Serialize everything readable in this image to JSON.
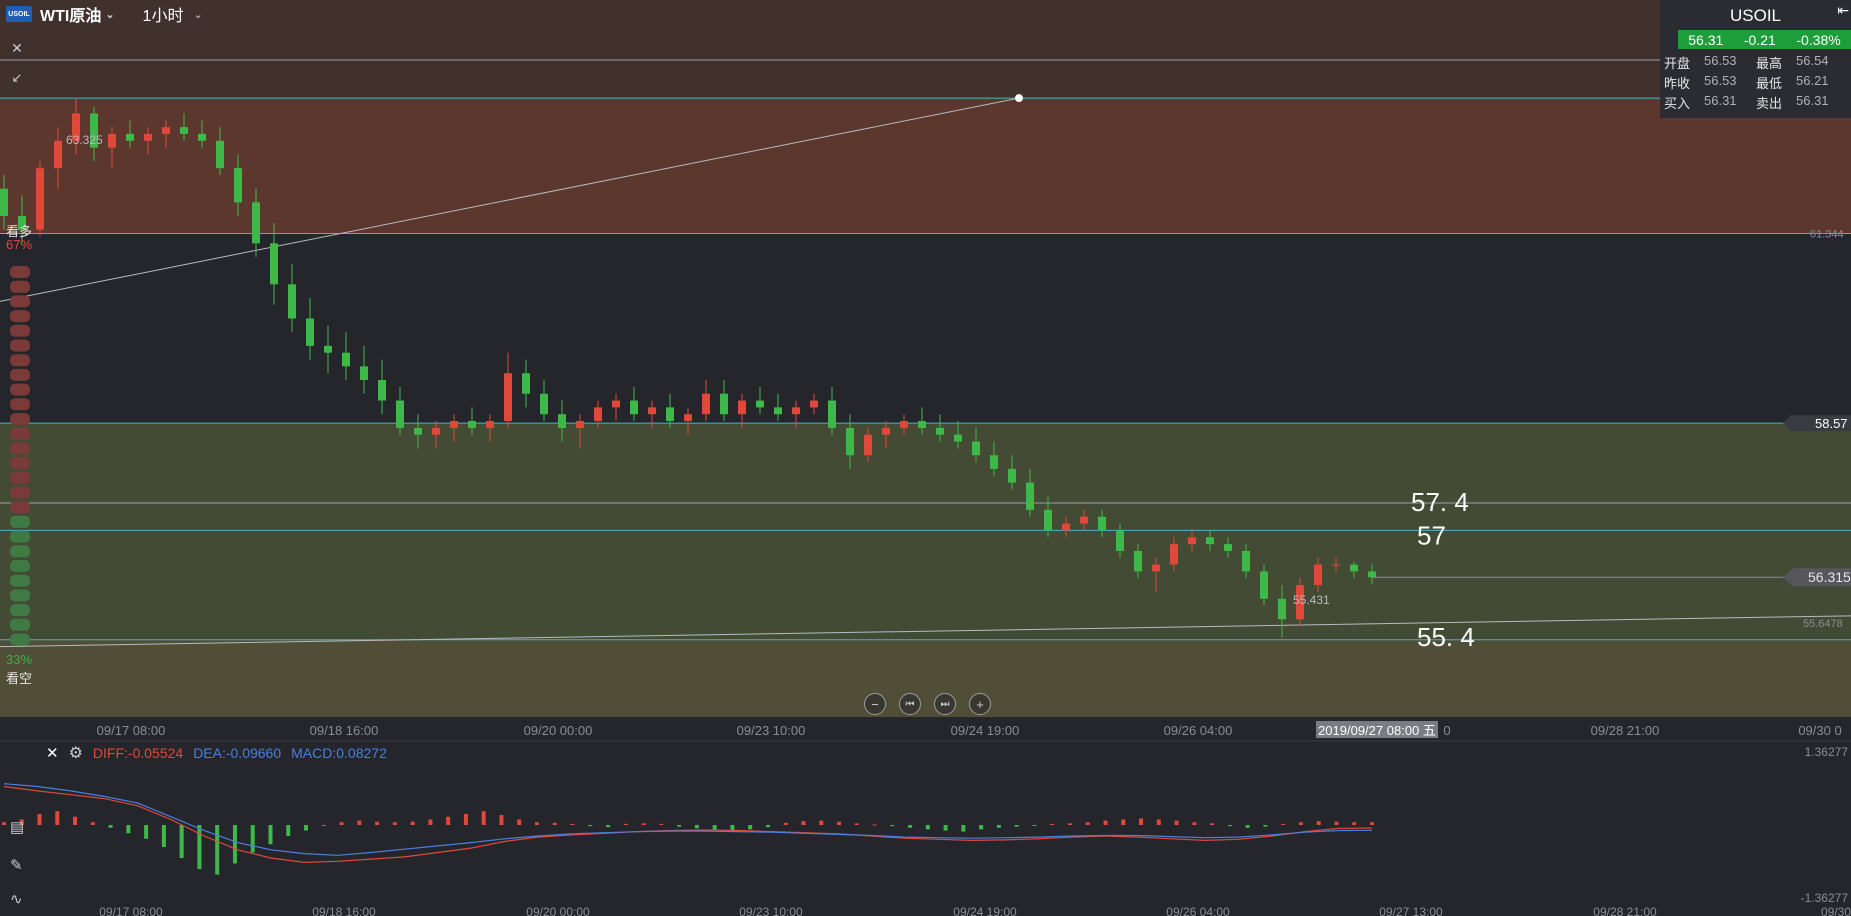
{
  "header": {
    "logo_text": "USOIL",
    "symbol_name": "WTI原油",
    "period": "1小时"
  },
  "quote": {
    "title": "USOIL",
    "last": "56.31",
    "change": "-0.21",
    "change_pct": "-0.38%",
    "rows": [
      {
        "l1": "开盘",
        "v1": "56.53",
        "l2": "最高",
        "v2": "56.54"
      },
      {
        "l1": "昨收",
        "v1": "56.53",
        "l2": "最低",
        "v2": "56.21"
      },
      {
        "l1": "买入",
        "v1": "56.31",
        "l2": "卖出",
        "v2": "56.31"
      }
    ]
  },
  "sentiment": {
    "bull_label": "看多",
    "bull_pct": "67%",
    "bear_pct": "33%",
    "bear_label": "看空",
    "bull_pct_value": 67
  },
  "chart_data": {
    "type": "candlestick",
    "symbol": "USOIL",
    "interval": "1小时",
    "y_range": [
      54.27,
      64.76
    ],
    "x_ticks": [
      "09/17 08:00",
      "09/18 16:00",
      "09/20 00:00",
      "09/23 10:00",
      "09/24 19:00",
      "09/26 04:00",
      "09/28 21:00",
      "09/30 0"
    ],
    "crosshair_time": "2019/09/27 08:00 五",
    "crosshair_suffix": "0",
    "high_label": "63.325",
    "low_label": "55.431",
    "right_labels": {
      "level_61": "61.344",
      "level_5857": "58.57",
      "last": "56.315",
      "trend": "55.6478"
    },
    "annotations": [
      "57. 4",
      "57",
      "55. 4"
    ],
    "horizontal_levels": [
      63.325,
      61.344,
      58.57,
      57.4,
      57.0,
      55.4
    ],
    "bands": [
      {
        "from": 61.344,
        "to": 63.325,
        "color": "#8a4630"
      },
      {
        "from": 63.325,
        "to": 64.76,
        "color": "#5a3a30"
      },
      {
        "from": 55.4,
        "to": 58.57,
        "color": "#5f6a3c"
      },
      {
        "from": 54.27,
        "to": 55.4,
        "color": "#75703f"
      }
    ],
    "candles": [
      [
        62.0,
        62.2,
        61.4,
        61.6
      ],
      [
        61.6,
        61.9,
        61.2,
        61.4
      ],
      [
        61.4,
        62.4,
        61.3,
        62.3
      ],
      [
        62.3,
        62.9,
        62.0,
        62.7
      ],
      [
        62.7,
        63.325,
        62.5,
        63.1
      ],
      [
        63.1,
        63.2,
        62.4,
        62.6
      ],
      [
        62.6,
        62.9,
        62.3,
        62.8
      ],
      [
        62.8,
        63.0,
        62.6,
        62.7
      ],
      [
        62.7,
        62.9,
        62.5,
        62.8
      ],
      [
        62.8,
        63.0,
        62.6,
        62.9
      ],
      [
        62.9,
        63.1,
        62.7,
        62.8
      ],
      [
        62.8,
        63.0,
        62.6,
        62.7
      ],
      [
        62.7,
        62.9,
        62.2,
        62.3
      ],
      [
        62.3,
        62.5,
        61.6,
        61.8
      ],
      [
        61.8,
        62.0,
        61.0,
        61.2
      ],
      [
        61.2,
        61.5,
        60.3,
        60.6
      ],
      [
        60.6,
        60.9,
        59.9,
        60.1
      ],
      [
        60.1,
        60.4,
        59.5,
        59.7
      ],
      [
        59.7,
        60.0,
        59.3,
        59.6
      ],
      [
        59.6,
        59.9,
        59.2,
        59.4
      ],
      [
        59.4,
        59.7,
        59.0,
        59.2
      ],
      [
        59.2,
        59.5,
        58.7,
        58.9
      ],
      [
        58.9,
        59.1,
        58.4,
        58.5
      ],
      [
        58.5,
        58.7,
        58.2,
        58.4
      ],
      [
        58.4,
        58.6,
        58.2,
        58.5
      ],
      [
        58.5,
        58.7,
        58.3,
        58.6
      ],
      [
        58.6,
        58.8,
        58.4,
        58.5
      ],
      [
        58.5,
        58.7,
        58.3,
        58.6
      ],
      [
        58.6,
        59.6,
        58.5,
        59.3
      ],
      [
        59.3,
        59.5,
        58.8,
        59.0
      ],
      [
        59.0,
        59.2,
        58.6,
        58.7
      ],
      [
        58.7,
        58.9,
        58.3,
        58.5
      ],
      [
        58.5,
        58.7,
        58.2,
        58.6
      ],
      [
        58.6,
        58.9,
        58.5,
        58.8
      ],
      [
        58.8,
        59.0,
        58.6,
        58.9
      ],
      [
        58.9,
        59.1,
        58.6,
        58.7
      ],
      [
        58.7,
        58.9,
        58.5,
        58.8
      ],
      [
        58.8,
        59.0,
        58.5,
        58.6
      ],
      [
        58.6,
        58.8,
        58.4,
        58.7
      ],
      [
        58.7,
        59.2,
        58.6,
        59.0
      ],
      [
        59.0,
        59.2,
        58.6,
        58.7
      ],
      [
        58.7,
        59.0,
        58.5,
        58.9
      ],
      [
        58.9,
        59.1,
        58.7,
        58.8
      ],
      [
        58.8,
        59.0,
        58.6,
        58.7
      ],
      [
        58.7,
        58.9,
        58.5,
        58.8
      ],
      [
        58.8,
        59.0,
        58.7,
        58.9
      ],
      [
        58.9,
        59.1,
        58.4,
        58.5
      ],
      [
        58.5,
        58.7,
        57.9,
        58.1
      ],
      [
        58.1,
        58.5,
        58.0,
        58.4
      ],
      [
        58.4,
        58.6,
        58.2,
        58.5
      ],
      [
        58.5,
        58.7,
        58.4,
        58.6
      ],
      [
        58.6,
        58.8,
        58.4,
        58.5
      ],
      [
        58.5,
        58.7,
        58.3,
        58.4
      ],
      [
        58.4,
        58.6,
        58.2,
        58.3
      ],
      [
        58.3,
        58.5,
        58.0,
        58.1
      ],
      [
        58.1,
        58.3,
        57.8,
        57.9
      ],
      [
        57.9,
        58.1,
        57.6,
        57.7
      ],
      [
        57.7,
        57.9,
        57.2,
        57.3
      ],
      [
        57.3,
        57.5,
        56.9,
        57.0
      ],
      [
        57.0,
        57.2,
        56.9,
        57.1
      ],
      [
        57.1,
        57.3,
        57.0,
        57.2
      ],
      [
        57.2,
        57.3,
        56.9,
        57.0
      ],
      [
        57.0,
        57.1,
        56.6,
        56.7
      ],
      [
        56.7,
        56.8,
        56.3,
        56.4
      ],
      [
        56.4,
        56.6,
        56.1,
        56.5
      ],
      [
        56.5,
        56.9,
        56.4,
        56.8
      ],
      [
        56.8,
        57.0,
        56.7,
        56.9
      ],
      [
        56.9,
        57.0,
        56.7,
        56.8
      ],
      [
        56.8,
        56.9,
        56.6,
        56.7
      ],
      [
        56.7,
        56.8,
        56.3,
        56.4
      ],
      [
        56.4,
        56.5,
        55.9,
        56.0
      ],
      [
        56.0,
        56.2,
        55.431,
        55.7
      ],
      [
        55.7,
        56.3,
        55.6,
        56.2
      ],
      [
        56.2,
        56.6,
        56.1,
        56.5
      ],
      [
        56.5,
        56.6,
        56.4,
        56.5
      ],
      [
        56.5,
        56.54,
        56.3,
        56.4
      ],
      [
        56.4,
        56.5,
        56.21,
        56.315
      ]
    ],
    "macd": {
      "diff_label": "DIFF:-0.05524",
      "dea_label": "DEA:-0.09660",
      "macd_label": "MACD:0.08272",
      "y_max_label": "1.36277",
      "y_min_label": "-1.36277",
      "y_range": [
        -1.36277,
        1.36277
      ],
      "hist": [
        0.05,
        0.1,
        0.2,
        0.25,
        0.15,
        0.05,
        -0.05,
        -0.15,
        -0.25,
        -0.4,
        -0.6,
        -0.8,
        -0.9,
        -0.7,
        -0.5,
        -0.35,
        -0.2,
        -0.1,
        0.0,
        0.05,
        0.08,
        0.06,
        0.05,
        0.06,
        0.1,
        0.15,
        0.2,
        0.25,
        0.18,
        0.1,
        0.05,
        0.04,
        0.02,
        -0.02,
        -0.04,
        0.02,
        0.03,
        0.02,
        -0.03,
        -0.06,
        -0.1,
        -0.12,
        -0.08,
        -0.04,
        0.04,
        0.07,
        0.08,
        0.06,
        0.03,
        0.01,
        -0.02,
        -0.05,
        -0.08,
        -0.1,
        -0.12,
        -0.08,
        -0.05,
        -0.03,
        -0.01,
        0.02,
        0.03,
        0.05,
        0.08,
        0.1,
        0.12,
        0.1,
        0.08,
        0.05,
        0.03,
        -0.02,
        -0.05,
        -0.03,
        0.02,
        0.05,
        0.07,
        0.06,
        0.05,
        0.05
      ],
      "diff": [
        0.7,
        0.62,
        0.55,
        0.48,
        0.35,
        0.1,
        -0.2,
        -0.45,
        -0.6,
        -0.68,
        -0.66,
        -0.62,
        -0.58,
        -0.5,
        -0.42,
        -0.3,
        -0.22,
        -0.18,
        -0.15,
        -0.12,
        -0.1,
        -0.09,
        -0.1,
        -0.12,
        -0.14,
        -0.16,
        -0.2,
        -0.24,
        -0.26,
        -0.28,
        -0.27,
        -0.25,
        -0.22,
        -0.2,
        -0.22,
        -0.25,
        -0.28,
        -0.26,
        -0.2,
        -0.12,
        -0.06,
        -0.055
      ],
      "dea": [
        0.75,
        0.7,
        0.62,
        0.52,
        0.4,
        0.15,
        -0.1,
        -0.32,
        -0.45,
        -0.52,
        -0.55,
        -0.5,
        -0.44,
        -0.38,
        -0.32,
        -0.25,
        -0.2,
        -0.16,
        -0.14,
        -0.12,
        -0.11,
        -0.11,
        -0.12,
        -0.13,
        -0.15,
        -0.17,
        -0.19,
        -0.22,
        -0.23,
        -0.24,
        -0.23,
        -0.22,
        -0.2,
        -0.19,
        -0.19,
        -0.21,
        -0.23,
        -0.22,
        -0.18,
        -0.13,
        -0.1,
        -0.097
      ],
      "x_ticks": [
        "09/17 08:00",
        "09/18 16:00",
        "09/20 00:00",
        "09/23 10:00",
        "09/24 19:00",
        "09/26 04:00",
        "09/27 13:00",
        "09/28 21:00",
        "09/30"
      ]
    }
  }
}
